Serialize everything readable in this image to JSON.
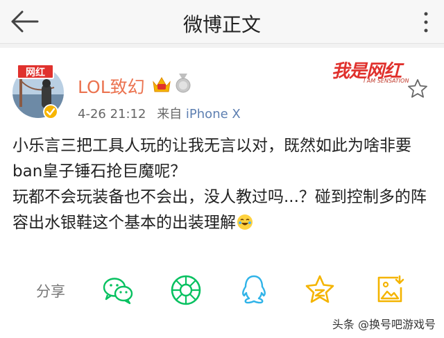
{
  "header": {
    "title": "微博正文"
  },
  "author": {
    "badge": "网红",
    "name": "LOL致幻",
    "time": "4-26 21:12",
    "from_label": "来自",
    "device": "iPhone X"
  },
  "watermark": {
    "main": "我是网红",
    "sub": "I AM SENSATION"
  },
  "post": {
    "paragraph1": "小乐言三把工具人玩的让我无言以对，既然如此为啥非要ban皇子锤石抢巨魔呢？",
    "paragraph2": "玩都不会玩装备也不会出，没人教过吗...？碰到控制多的阵容出水银鞋这个基本的出装理解"
  },
  "share": {
    "label": "分享",
    "icons": [
      "wechat-icon",
      "moments-icon",
      "qq-icon",
      "qzone-star-icon",
      "save-image-icon"
    ]
  },
  "footer": {
    "source": "头条 @换号吧游戏号"
  },
  "colors": {
    "accent": "#eb7350",
    "green": "#07c160",
    "qq": "#2fb3e8",
    "gold": "#f4b400",
    "red": "#e0312d"
  }
}
